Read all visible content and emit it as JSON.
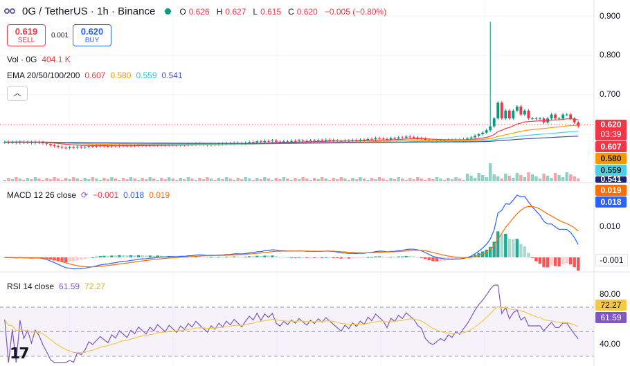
{
  "header": {
    "symbol": "0G / TetherUS · 1h · Binance",
    "o_label": "O",
    "o": "0.626",
    "h_label": "H",
    "h": "0.627",
    "l_label": "L",
    "l": "0.615",
    "c_label": "C",
    "c": "0.620",
    "change": "−0.005 (−0.80%)"
  },
  "trade": {
    "sell_price": "0.619",
    "sell_label": "SELL",
    "spread": "0.001",
    "buy_price": "0.620",
    "buy_label": "BUY"
  },
  "volume": {
    "label": "Vol · 0G",
    "value": "404.1 K"
  },
  "ema": {
    "label": "EMA 20/50/100/200",
    "v20": "0.607",
    "v50": "0.580",
    "v100": "0.559",
    "v200": "0.541"
  },
  "macd": {
    "label": "MACD 12 26 close",
    "hist": "−0.001",
    "macd": "0.018",
    "signal": "0.019"
  },
  "rsi": {
    "label": "RSI 14 close",
    "rsi": "61.59",
    "ma": "72.27"
  },
  "price_axis": [
    "0.900",
    "0.800",
    "0.700"
  ],
  "macd_axis": [
    "0.010"
  ],
  "rsi_axis": [
    "80.00",
    "40.00"
  ],
  "tags": {
    "last_price": "0.620",
    "countdown": "03:39",
    "ema20": "0.607",
    "ema50": "0.580",
    "ema100": "0.559",
    "ema200": "0.541",
    "macd_signal": "0.019",
    "macd_line": "0.018",
    "macd_hist": "-0.001",
    "rsi_ma": "72.27",
    "rsi": "61.59"
  },
  "colors": {
    "up": "#089981",
    "down": "#f23645",
    "ema20": "#f23645",
    "ema50": "#ff9800",
    "ema100": "#4dd0e1",
    "ema200": "#3f51b5",
    "macd": "#2962ff",
    "signal": "#ff6d00",
    "rsi": "#7e57c2",
    "rsi_ma": "#f7c844"
  },
  "chart_data": {
    "type": "candlestick",
    "price_range": [
      0.5,
      0.9
    ],
    "close_series": [
      0.58,
      0.579,
      0.58,
      0.578,
      0.581,
      0.579,
      0.58,
      0.578,
      0.58,
      0.579,
      0.577,
      0.575,
      0.572,
      0.57,
      0.568,
      0.566,
      0.565,
      0.567,
      0.566,
      0.568,
      0.567,
      0.568,
      0.57,
      0.569,
      0.57,
      0.571,
      0.57,
      0.569,
      0.571,
      0.57,
      0.572,
      0.571,
      0.57,
      0.572,
      0.571,
      0.573,
      0.572,
      0.571,
      0.573,
      0.572,
      0.574,
      0.573,
      0.572,
      0.574,
      0.573,
      0.572,
      0.574,
      0.573,
      0.575,
      0.574,
      0.576,
      0.575,
      0.574,
      0.573,
      0.575,
      0.574,
      0.576,
      0.575,
      0.577,
      0.576,
      0.578,
      0.577,
      0.576,
      0.578,
      0.58,
      0.579,
      0.582,
      0.58,
      0.583,
      0.582,
      0.584,
      0.581,
      0.58,
      0.582,
      0.581,
      0.583,
      0.582,
      0.584,
      0.583,
      0.582,
      0.584,
      0.583,
      0.585,
      0.584,
      0.586,
      0.585,
      0.584,
      0.583,
      0.582,
      0.584,
      0.583,
      0.585,
      0.584,
      0.586,
      0.585,
      0.588,
      0.587,
      0.59,
      0.589,
      0.588,
      0.586,
      0.59,
      0.589,
      0.592,
      0.591,
      0.594,
      0.593,
      0.592,
      0.59,
      0.589,
      0.585,
      0.583,
      0.582,
      0.583,
      0.584,
      0.583,
      0.585,
      0.584,
      0.586,
      0.585,
      0.587,
      0.589,
      0.592,
      0.596,
      0.6,
      0.604,
      0.61,
      0.62,
      0.64,
      0.68,
      0.64,
      0.66,
      0.64,
      0.66,
      0.67,
      0.65,
      0.66,
      0.64,
      0.64,
      0.64,
      0.64,
      0.63,
      0.64,
      0.65,
      0.64,
      0.64,
      0.65,
      0.65,
      0.64,
      0.63,
      0.62
    ],
    "x_label": "",
    "y_label": ""
  }
}
